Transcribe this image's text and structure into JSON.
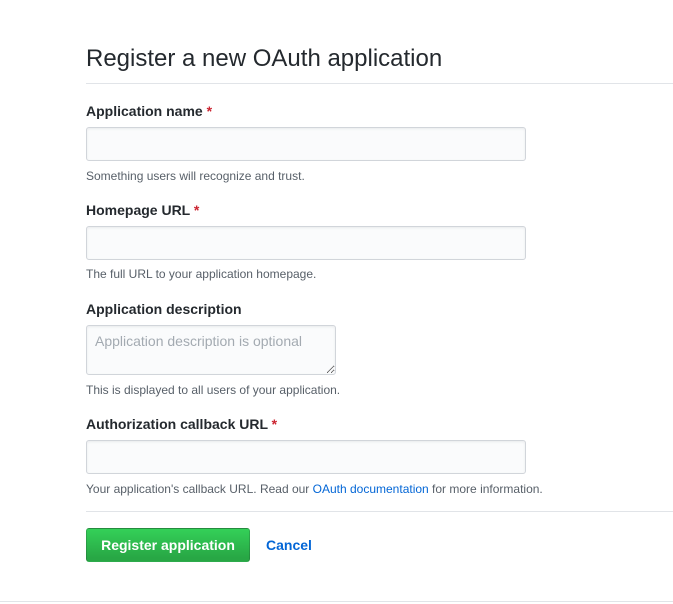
{
  "page": {
    "title": "Register a new OAuth application"
  },
  "form": {
    "required_marker": "*",
    "app_name": {
      "label": "Application name",
      "value": "",
      "note": "Something users will recognize and trust."
    },
    "homepage_url": {
      "label": "Homepage URL",
      "value": "",
      "note": "The full URL to your application homepage."
    },
    "description": {
      "label": "Application description",
      "placeholder": "Application description is optional",
      "value": "",
      "note": "This is displayed to all users of your application."
    },
    "callback_url": {
      "label": "Authorization callback URL",
      "value": "",
      "note_before": "Your application's callback URL. Read our ",
      "note_link": "OAuth documentation",
      "note_after": " for more information."
    }
  },
  "actions": {
    "register_label": "Register application",
    "cancel_label": "Cancel"
  },
  "colors": {
    "primary_button": "#28a745",
    "link": "#0366d6",
    "required": "#cb2431"
  }
}
